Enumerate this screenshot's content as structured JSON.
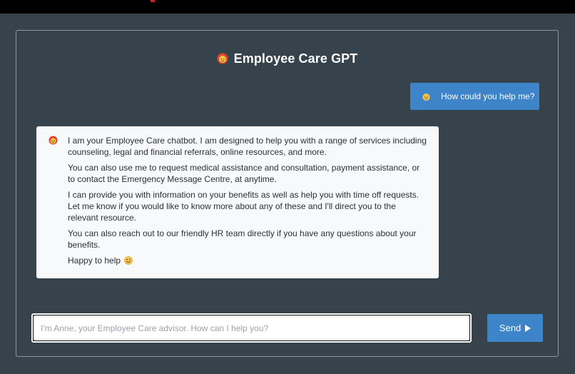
{
  "header": {
    "title": "Employee Care GPT",
    "title_icon": "woman-advisor-emoji"
  },
  "chat": {
    "user_message": {
      "icon": "person-emoji",
      "text": "How could you help me?"
    },
    "bot_message": {
      "icon": "woman-advisor-emoji",
      "paragraphs": [
        "I am your Employee Care chatbot. I am designed to help you with a range of services including counseling, legal and financial referrals, online resources, and more.",
        "You can also use me to request medical assistance and consultation, payment assistance, or to contact the Emergency Message Centre, at anytime.",
        "I can provide you with information on your benefits as well as help you with time off requests. Let me know if you would like to know more about any of these and I'll direct you to the relevant resource.",
        "You can also reach out to our friendly HR team directly if you have any questions about your benefits."
      ],
      "sign_off": "Happy to help",
      "sign_off_icon": "smiling-face-emoji"
    }
  },
  "composer": {
    "placeholder": "I'm Anne, your Employee Care advisor. How can I help you?",
    "value": "",
    "send_label": "Send",
    "send_icon": "play-icon"
  },
  "colors": {
    "background": "#36434d",
    "accent": "#3d84c8",
    "bot_bubble": "#f8f9fb",
    "topbar": "#000000"
  }
}
